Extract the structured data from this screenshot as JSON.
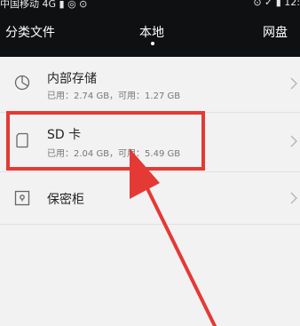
{
  "status_bar": {
    "left": "中国移动 4G ▮ ◎ ⊙",
    "right": "⊙ ✓ ▮ 12:"
  },
  "tabs": [
    {
      "label": "分类文件"
    },
    {
      "label": "本地"
    },
    {
      "label": "网盘"
    }
  ],
  "storage": [
    {
      "title": "内部存储",
      "subtitle": "已用：2.74 GB，可用：1.27 GB",
      "icon": "pie-chart-icon"
    },
    {
      "title": "SD 卡",
      "subtitle": "已用：2.04 GB，可用：5.49 GB",
      "icon": "sd-card-icon"
    },
    {
      "title": "保密柜",
      "subtitle": "",
      "icon": "safe-icon"
    }
  ],
  "annotation": {
    "color": "#e53935"
  }
}
